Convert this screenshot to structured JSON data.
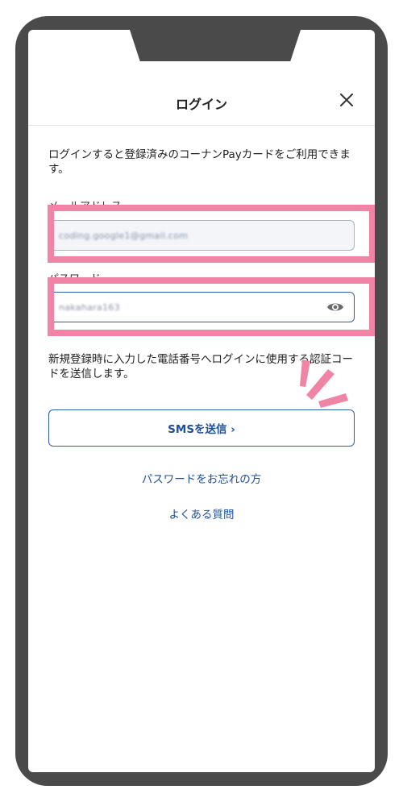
{
  "dialog": {
    "title": "ログイン",
    "close_icon": "close-icon",
    "intro": "ログインすると登録済みのコーナンPayカードをご利用できます。"
  },
  "email": {
    "label": "メールアドレス",
    "value": "coding.google1@gmail.com"
  },
  "password": {
    "label": "パスワード",
    "value": "nakahara163",
    "toggle_icon": "eye-icon"
  },
  "note": "新規登録時に入力した電話番号へログインに使用する認証コードを送信します。",
  "sms_button": {
    "label": "SMSを送信 ›"
  },
  "links": {
    "forgot_password": "パスワードをお忘れの方",
    "faq": "よくある質問"
  },
  "colors": {
    "accent": "#1f4f99",
    "highlight": "#ef84a4",
    "frame": "#4a4a4a"
  }
}
